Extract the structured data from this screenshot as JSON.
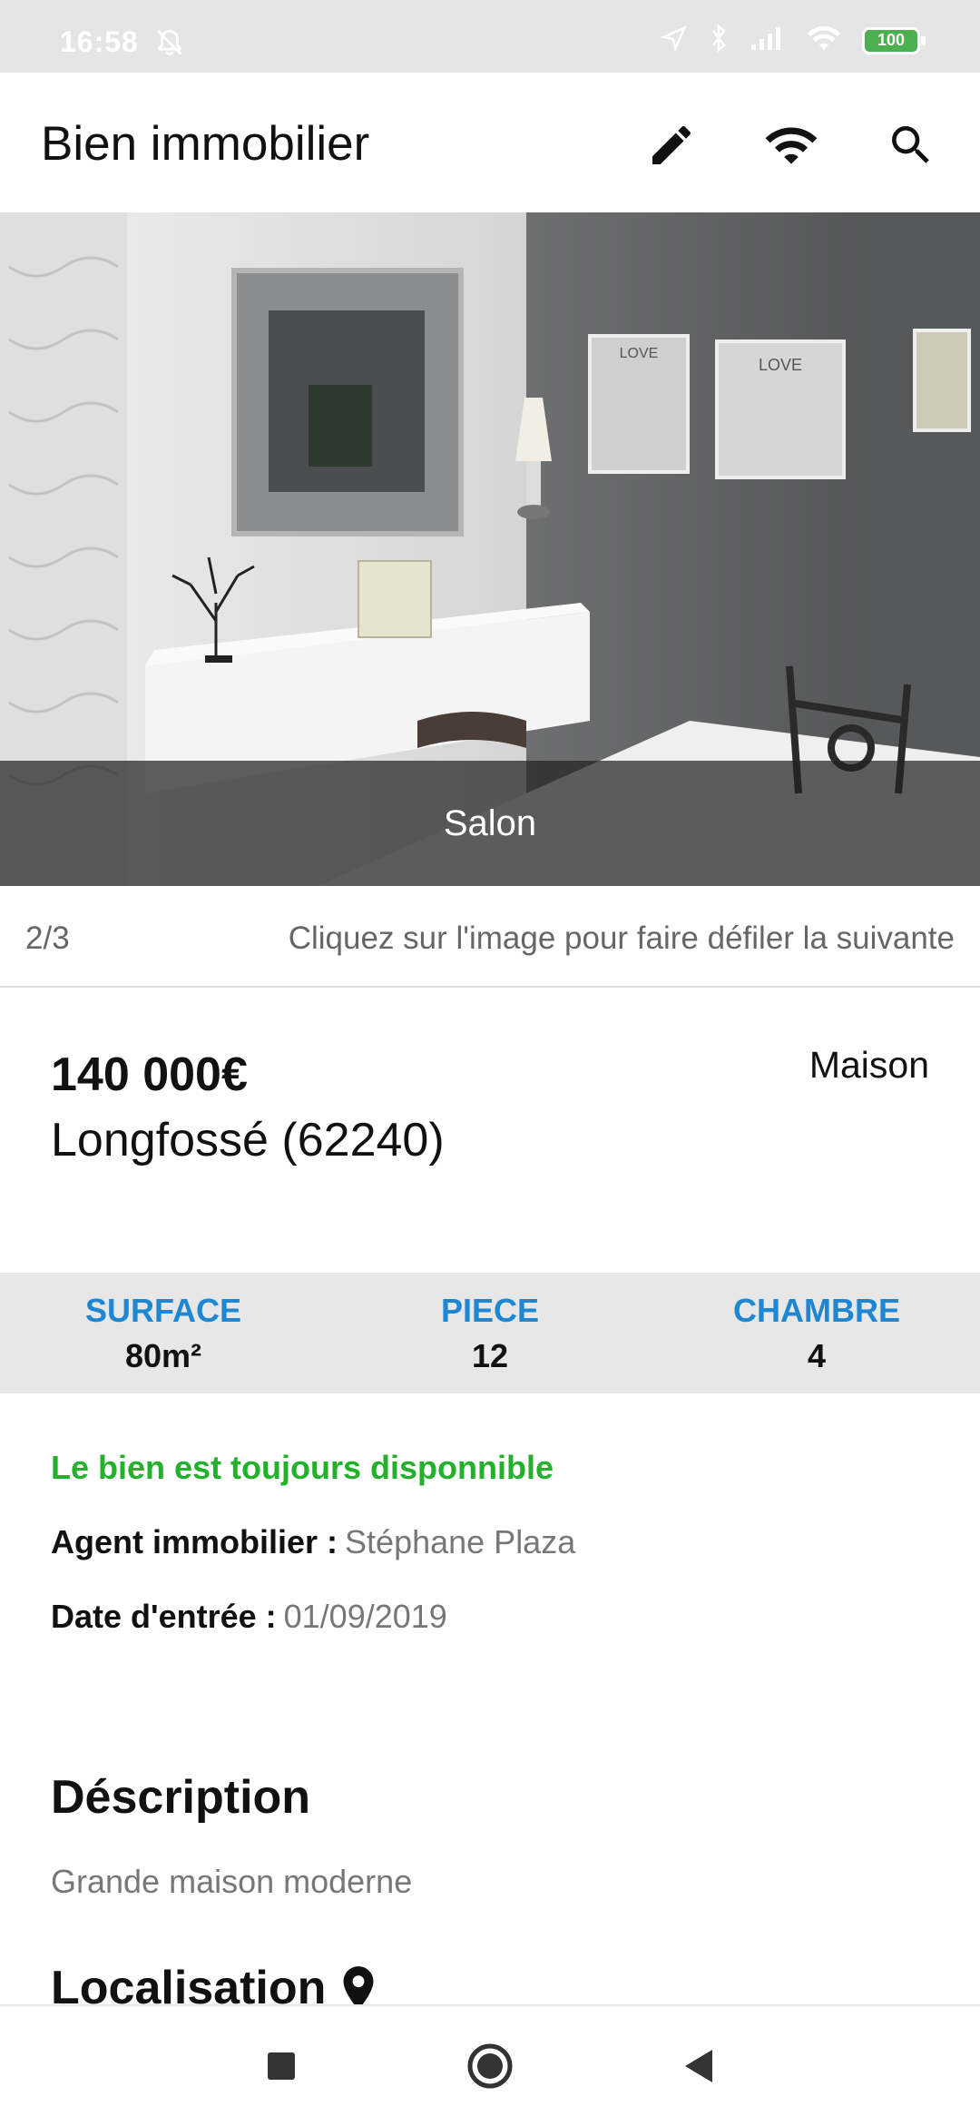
{
  "status_bar": {
    "time": "16:58",
    "battery": "100"
  },
  "app_bar": {
    "title": "Bien immobilier"
  },
  "gallery": {
    "caption": "Salon",
    "counter": "2/3",
    "hint": "Cliquez sur l'image pour faire défiler la suivante",
    "wall_frames": [
      "LOVE",
      "LOVE"
    ]
  },
  "listing": {
    "price": "140 000€",
    "city": "Longfossé  (62240)",
    "type": "Maison"
  },
  "stats": [
    {
      "label": "SURFACE",
      "value": "80m²"
    },
    {
      "label": "PIECE",
      "value": "12"
    },
    {
      "label": "CHAMBRE",
      "value": "4"
    }
  ],
  "details": {
    "availability": "Le bien est toujours disponnible",
    "agent_label": "Agent immobilier :",
    "agent_value": "Stéphane Plaza",
    "date_label": "Date d'entrée :",
    "date_value": "01/09/2019"
  },
  "description": {
    "heading": "Déscription",
    "text": "Grande maison moderne"
  },
  "location": {
    "heading": "Localisation"
  },
  "colors": {
    "accent_blue": "#1f86d1",
    "available_green": "#22b12a",
    "stats_bg": "#e7e7e7"
  },
  "icons": [
    "edit-icon",
    "wifi-icon",
    "search-icon",
    "map-pin-icon",
    "nav-recents-icon",
    "nav-home-icon",
    "nav-back-icon"
  ]
}
